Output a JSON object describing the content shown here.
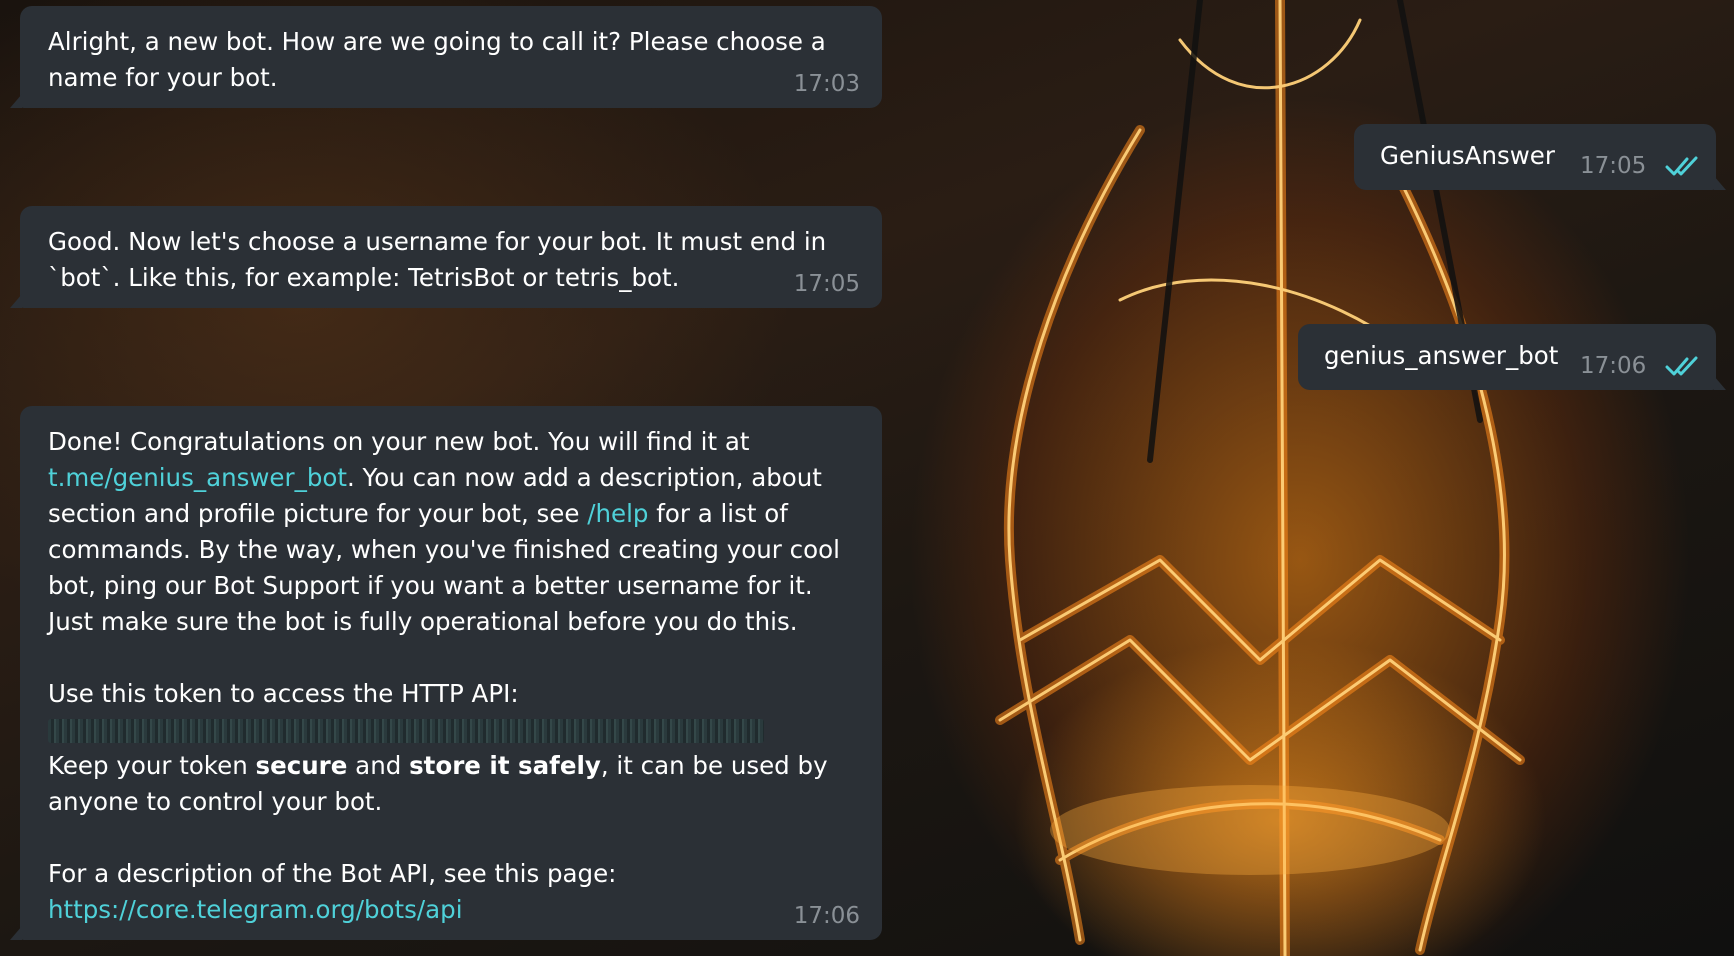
{
  "theme": {
    "bubble_color": "#2b3036",
    "link_color": "#4fd1d9",
    "time_color": "#8a9096",
    "check_color": "#4fd1d9"
  },
  "messages": [
    {
      "text": "Alright, a new bot. How are we going to call it? Please choose a name for your bot.",
      "time": "17:03"
    },
    {
      "text": "GeniusAnswer",
      "time": "17:05",
      "status_icon": "double-check-icon"
    },
    {
      "text": "Good. Now let's choose a username for your bot. It must end in `bot`. Like this, for example: TetrisBot or tetris_bot.",
      "time": "17:05"
    },
    {
      "text": "genius_answer_bot",
      "time": "17:06",
      "status_icon": "double-check-icon"
    },
    {
      "p1_a": "Done! Congratulations on your new bot. You will find it at ",
      "link_bot": "t.me/genius_answer_bot",
      "p1_b": ". You can now add a description, about section and profile picture for your bot, see ",
      "link_help": "/help",
      "p1_c": " for a list of commands. By the way, when you've finished creating your cool bot, ping our Bot Support if you want a better username for it. Just make sure the bot is fully operational before you do this.",
      "p2_a": "Use this token to access the HTTP API:",
      "p2_b": "Keep your token ",
      "p2_bold1": "secure",
      "p2_c": " and ",
      "p2_bold2": "store it safely",
      "p2_d": ", it can be used by anyone to control your bot.",
      "p3_a": "For a description of the Bot API, see this page:",
      "link_api": "https://core.telegram.org/bots/api",
      "time": "17:06"
    }
  ]
}
